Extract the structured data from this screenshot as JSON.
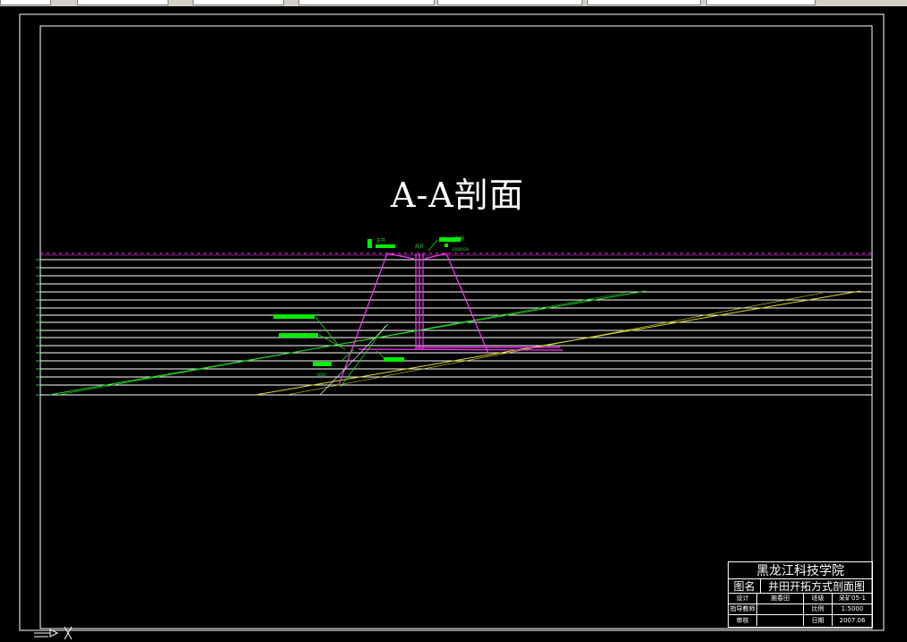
{
  "section_title": "A-A剖面",
  "colors": {
    "background": "#000000",
    "frame": "#ffffff",
    "strata_lines": "#ffffff",
    "coal_seam_green": "#22dd22",
    "coal_seam_yellow": "#dddd22",
    "shaft_magenta": "#ff33ff",
    "label_fill": "#00ee00"
  },
  "title_block": {
    "institution": "黑龙江科技学院",
    "drawing_name_label": "图名",
    "drawing_name": "井田开拓方式剖面图",
    "rows": [
      {
        "c1": "设计",
        "c2": "施春田",
        "c3": "班级",
        "c4": "采矿05-1"
      },
      {
        "c1": "指导教师",
        "c2": "",
        "c3": "比例",
        "c4": "1:5000"
      },
      {
        "c1": "审核",
        "c2": "",
        "c3": "日期",
        "c4": "2007.06"
      }
    ]
  },
  "annotations": {
    "shaft_left": "主井",
    "shaft_right": "副井",
    "shaft_center": "风井",
    "left_elev": "+20050/12",
    "right_elev": "20050/20",
    "left_bottom": "-5600"
  }
}
